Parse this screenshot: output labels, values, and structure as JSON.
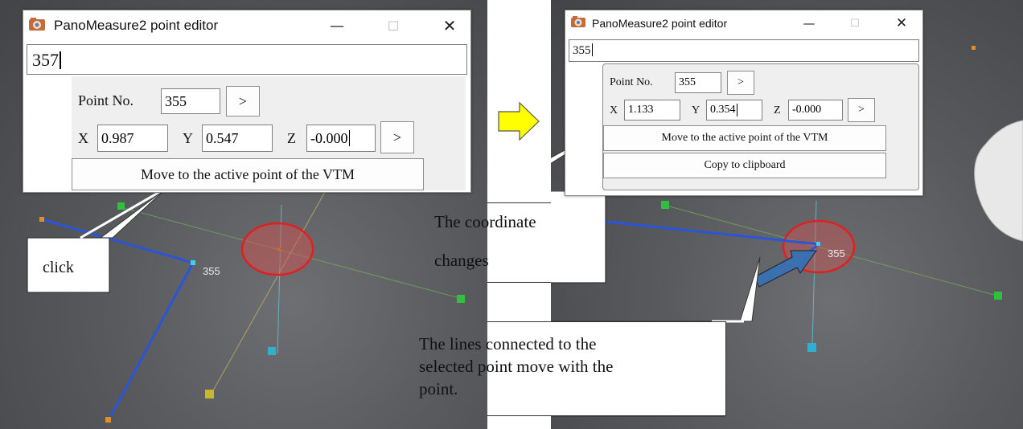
{
  "window": {
    "title": "PanoMeasure2 point editor",
    "minimize_glyph": "—",
    "maximize_glyph": "☐",
    "close_glyph": "✕"
  },
  "left": {
    "command_input": "357",
    "point_no_label": "Point No.",
    "point_no_value": "355",
    "next_button": ">",
    "x_label": "X",
    "x_value": "0.987",
    "y_label": "Y",
    "y_value": "0.547",
    "z_label": "Z",
    "z_value": "-0.000",
    "coord_next_button": ">",
    "move_button": "Move to the active point of the VTM",
    "point_label": "355",
    "callout": "click"
  },
  "right": {
    "command_input": "355",
    "point_no_label": "Point No.",
    "point_no_value": "355",
    "next_button": ">",
    "x_label": "X",
    "x_value": "1.133",
    "y_label": "Y",
    "y_value": "0.354",
    "z_label": "Z",
    "z_value": "-0.000",
    "coord_next_button": ">",
    "move_button": "Move to the active point of the VTM",
    "copy_button": "Copy to clipboard",
    "point_label": "355",
    "callout_coordinate_line1": "The coordinate",
    "callout_coordinate_line2": "changes",
    "callout_lines_line1": "The lines connected to the",
    "callout_lines_line2": "selected point move with the",
    "callout_lines_line3": "point."
  },
  "icons": {
    "transition_arrow": "right-arrow-icon",
    "app_icon": "camera-icon",
    "pointer_arrow": "pointer-arrow-icon"
  },
  "colors": {
    "arrow_yellow": "#ffff00",
    "line_blue": "#2a55d8",
    "circle_red": "#e02020",
    "pointer_blue": "#3a6fb0"
  }
}
